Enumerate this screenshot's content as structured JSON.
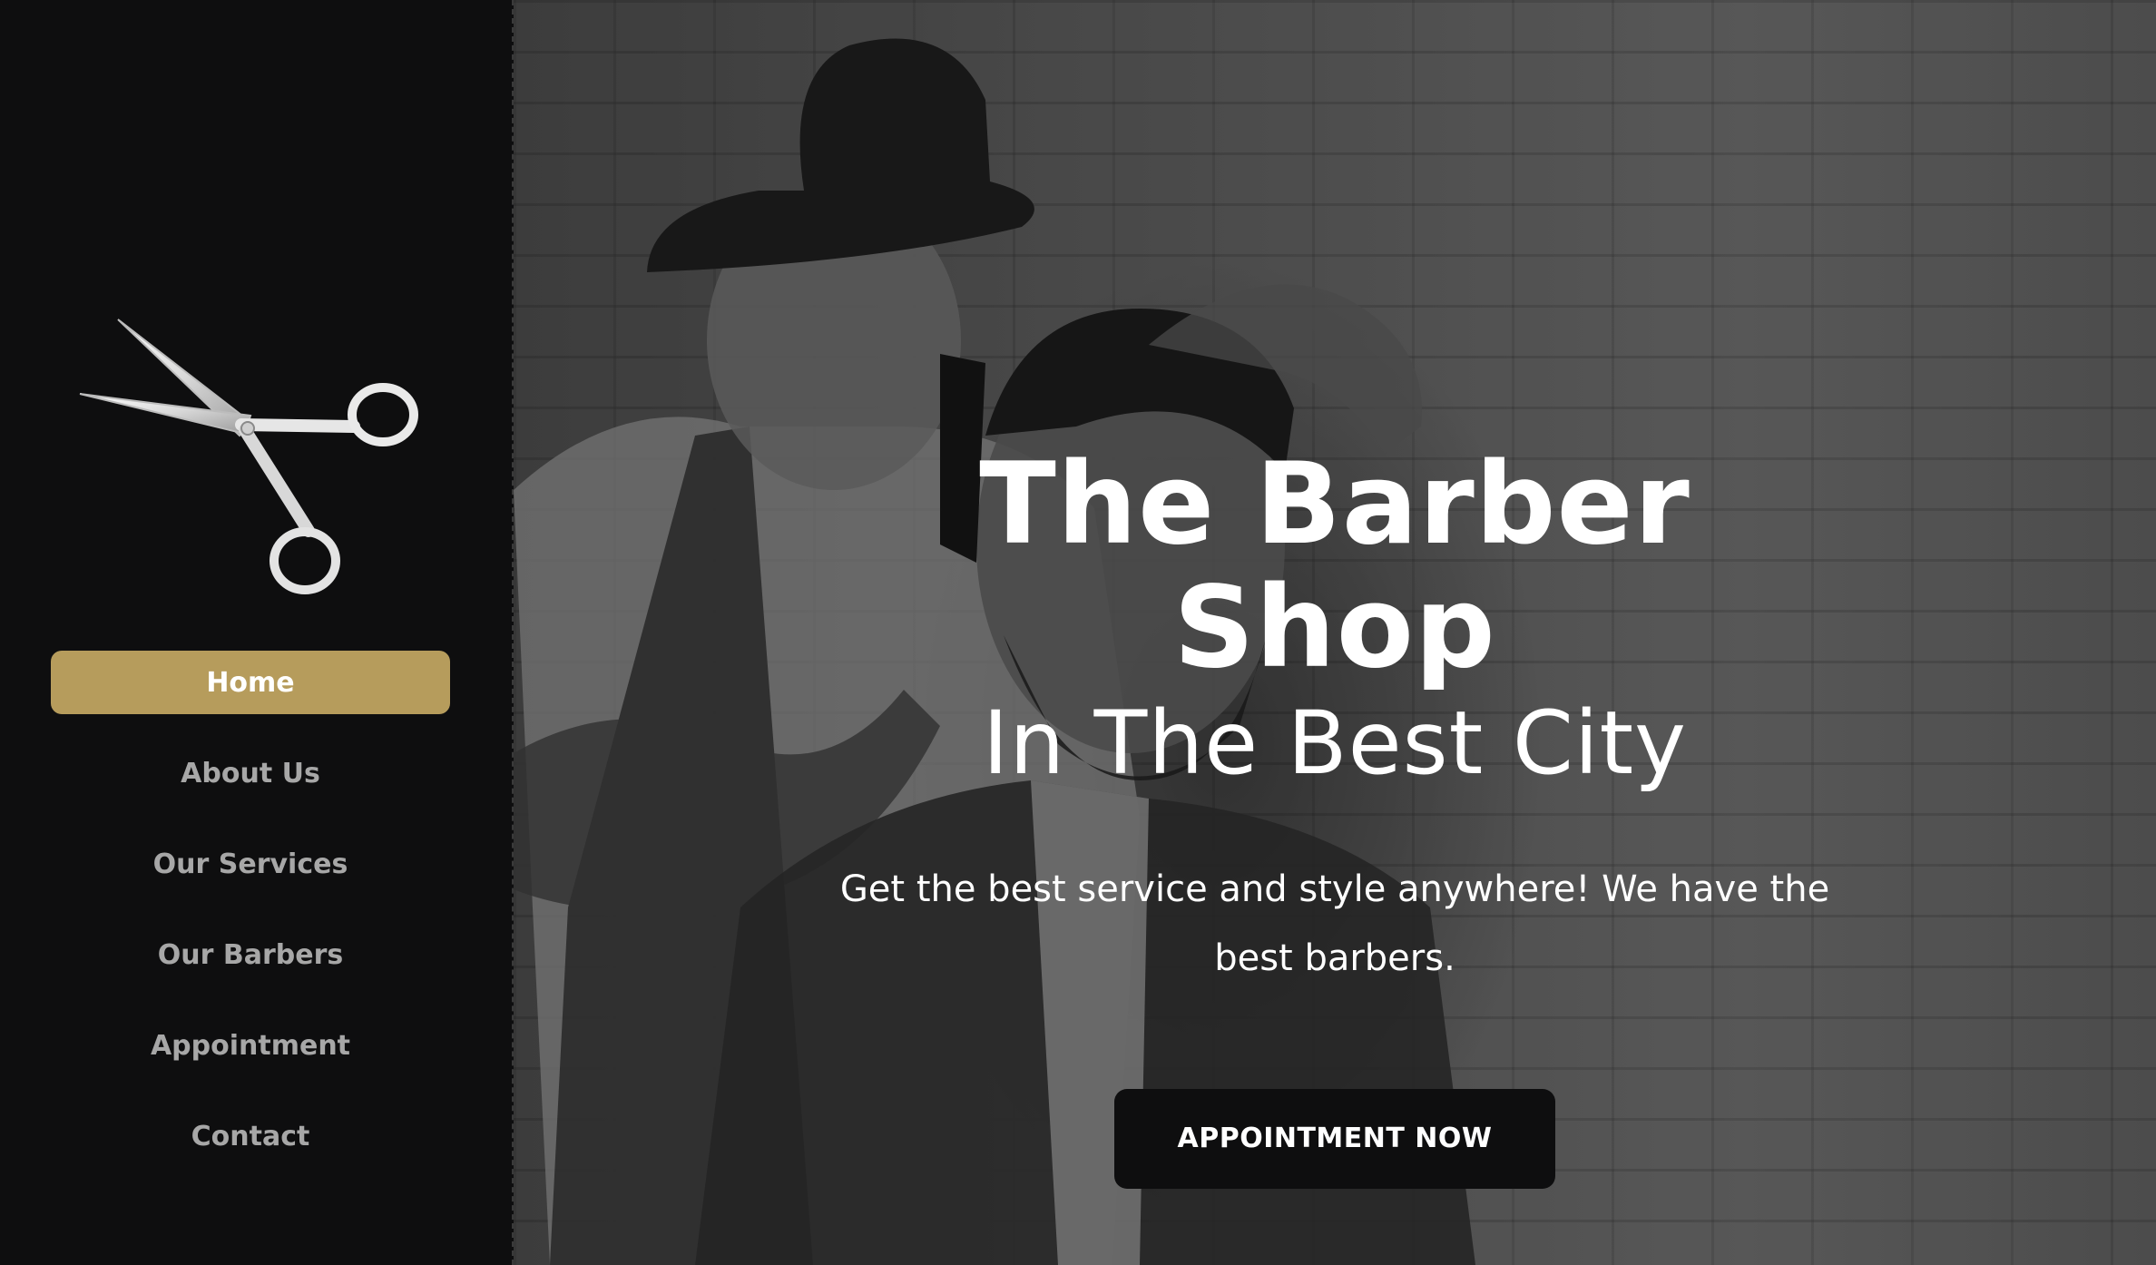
{
  "sidebar": {
    "logo_icon": "scissors-icon",
    "active_color": "#b69c5c",
    "nav": [
      {
        "label": "Home",
        "active": true
      },
      {
        "label": "About Us",
        "active": false
      },
      {
        "label": "Our Services",
        "active": false
      },
      {
        "label": "Our Barbers",
        "active": false
      },
      {
        "label": "Appointment",
        "active": false
      },
      {
        "label": "Contact",
        "active": false
      }
    ]
  },
  "hero": {
    "title_line1": "The Barber",
    "title_line2": "Shop",
    "subtitle": "In The Best City",
    "description": "Get the best service and style anywhere! We have the best barbers.",
    "cta_label": "APPOINTMENT NOW"
  }
}
